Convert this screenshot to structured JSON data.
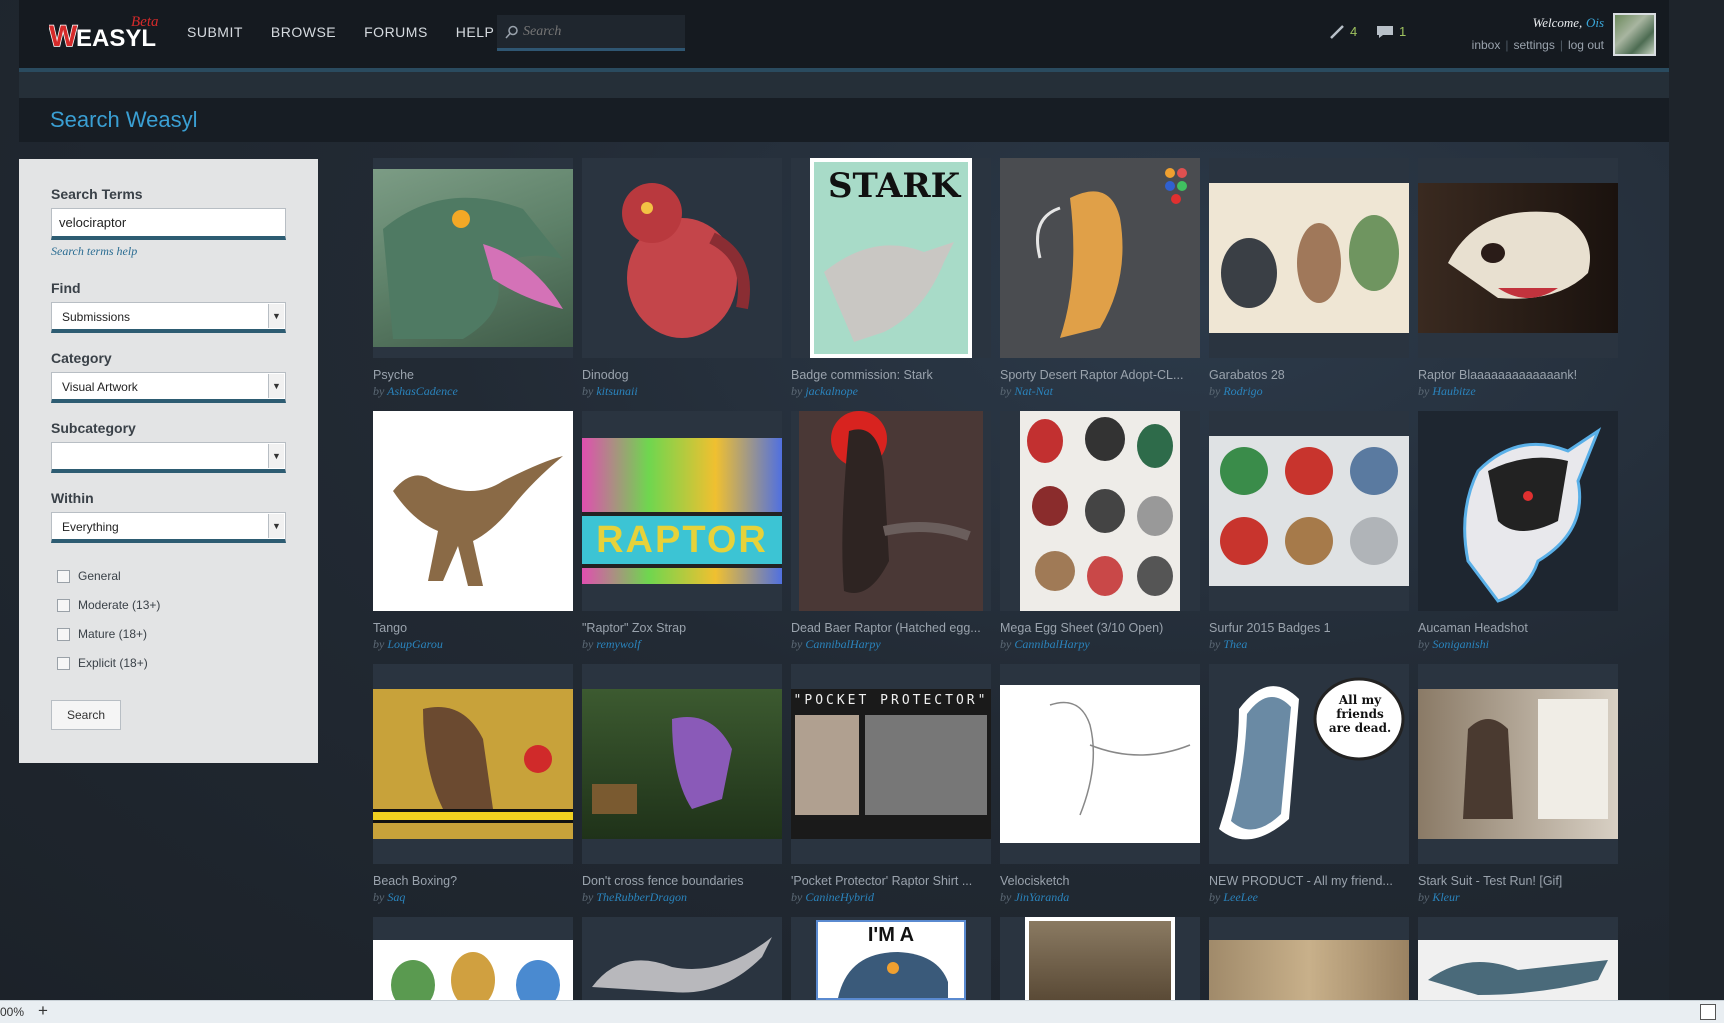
{
  "header": {
    "logo_main": "WEASYL",
    "logo_beta": "Beta",
    "nav": [
      "SUBMIT",
      "BROWSE",
      "FORUMS",
      "HELP"
    ],
    "search_placeholder": "Search",
    "notif_submissions": "4",
    "notif_comments": "1",
    "welcome": "Welcome,",
    "username": "Ois",
    "links": [
      "inbox",
      "settings",
      "log out"
    ]
  },
  "page_title": "Search Weasyl",
  "sidebar": {
    "search_terms_label": "Search Terms",
    "search_terms_value": "velociraptor",
    "help_link": "Search terms help",
    "find_label": "Find",
    "find_value": "Submissions",
    "category_label": "Category",
    "category_value": "Visual Artwork",
    "subcategory_label": "Subcategory",
    "subcategory_value": "",
    "within_label": "Within",
    "within_value": "Everything",
    "ratings": [
      "General",
      "Moderate (13+)",
      "Mature (18+)",
      "Explicit (18+)"
    ],
    "search_button": "Search"
  },
  "results": [
    {
      "title": "Psyche",
      "by": "by",
      "artist": "AshasCadence"
    },
    {
      "title": "Dinodog",
      "by": "by",
      "artist": "kitsunaii"
    },
    {
      "title": "Badge commission: Stark",
      "by": "by",
      "artist": "jackalnope"
    },
    {
      "title": "Sporty Desert Raptor Adopt-CL...",
      "by": "by",
      "artist": "Nat-Nat"
    },
    {
      "title": "Garabatos 28",
      "by": "by",
      "artist": "Rodrigo"
    },
    {
      "title": "Raptor Blaaaaaaaaaaaaank!",
      "by": "by",
      "artist": "Haubitze"
    },
    {
      "title": "Tango",
      "by": "by",
      "artist": "LoupGarou"
    },
    {
      "title": "\"Raptor\" Zox Strap",
      "by": "by",
      "artist": "remywolf"
    },
    {
      "title": "Dead Baer Raptor (Hatched egg...",
      "by": "by",
      "artist": "CannibalHarpy"
    },
    {
      "title": "Mega Egg Sheet (3/10 Open)",
      "by": "by",
      "artist": "CannibalHarpy"
    },
    {
      "title": "Surfur 2015 Badges 1",
      "by": "by",
      "artist": "Thea"
    },
    {
      "title": "Aucaman Headshot",
      "by": "by",
      "artist": "Soniganishi"
    },
    {
      "title": "Beach Boxing?",
      "by": "by",
      "artist": "Saq"
    },
    {
      "title": "Don't cross fence boundaries",
      "by": "by",
      "artist": "TheRubberDragon"
    },
    {
      "title": "'Pocket Protector' Raptor Shirt ...",
      "by": "by",
      "artist": "CanineHybrid"
    },
    {
      "title": "Velocisketch",
      "by": "by",
      "artist": "JinYaranda"
    },
    {
      "title": "NEW PRODUCT - All my friend...",
      "by": "by",
      "artist": "LeeLee"
    },
    {
      "title": "Stark Suit - Test Run! [Gif]",
      "by": "by",
      "artist": "Kleur"
    },
    {
      "title": "",
      "by": "",
      "artist": ""
    },
    {
      "title": "",
      "by": "",
      "artist": ""
    },
    {
      "title": "",
      "by": "",
      "artist": ""
    },
    {
      "title": "",
      "by": "",
      "artist": ""
    },
    {
      "title": "",
      "by": "",
      "artist": ""
    },
    {
      "title": "",
      "by": "",
      "artist": ""
    }
  ],
  "thumb_texts": {
    "stark": "STARK",
    "raptor_strap": "RAPTOR",
    "pocket": "\"POCKET PROTECTOR\"",
    "speech": "All my friends are dead.",
    "ima": "I'M A"
  },
  "status": {
    "zoom": "00%",
    "plus": "+"
  },
  "colors": {
    "accent": "#3a9fd3",
    "notif": "#9fc35f",
    "sidebar_bg": "#e3e4e5"
  }
}
